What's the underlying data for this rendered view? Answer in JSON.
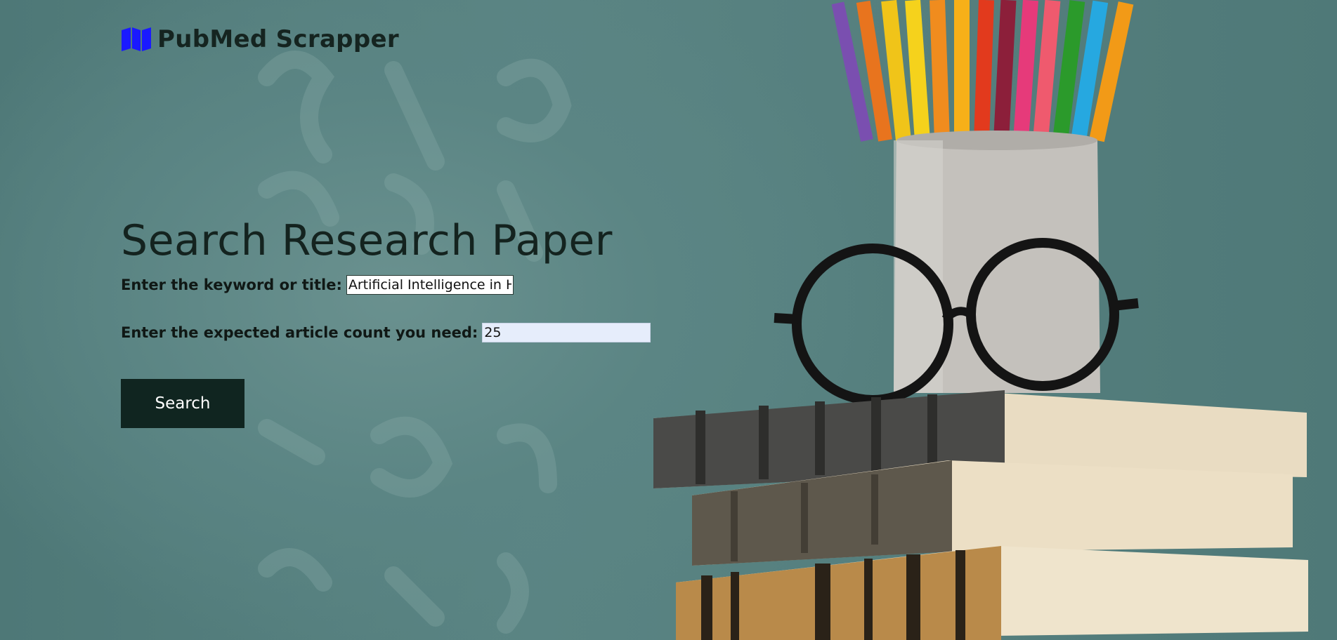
{
  "brand": {
    "name": "PubMed Scrapper",
    "icon": "map-icon",
    "icon_color": "#1a1aff"
  },
  "hero": {
    "title": "Search Research Paper"
  },
  "form": {
    "keyword": {
      "label": "Enter the keyword or title:",
      "value": "Artificial Intelligence in H"
    },
    "count": {
      "label": "Enter the expected article count you need:",
      "value": "25"
    },
    "submit_label": "Search"
  },
  "background": {
    "description_icons": [
      "chalkboard-image",
      "pencil-cup-image",
      "glasses-image",
      "book-stack-image"
    ]
  },
  "colors": {
    "chalkboard": "#547d7c",
    "button": "#102520",
    "heading": "#14231f"
  }
}
